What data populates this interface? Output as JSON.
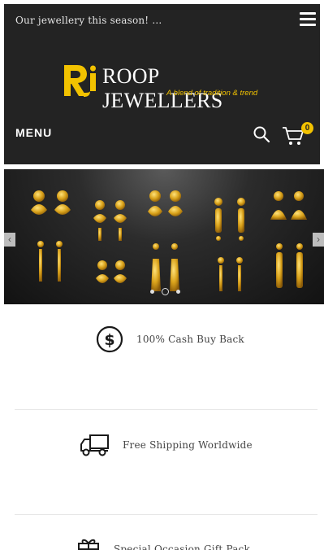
{
  "topbar": {
    "announcement": "Our jewellery this season! ..."
  },
  "logo": {
    "mark": "Rj",
    "name": "ROOP JEWELLERS",
    "tagline": "A blend of tradition & trend"
  },
  "nav": {
    "menu_label": "MENU",
    "cart_count": "0",
    "icons": [
      "hamburger-menu-icon",
      "search-icon",
      "cart-icon"
    ]
  },
  "slider": {
    "prev_glyph": "‹",
    "next_glyph": "›",
    "slide_count": 3,
    "active_slide": 2
  },
  "features": [
    {
      "icon": "dollar-coin-icon",
      "label": "100% Cash Buy Back"
    },
    {
      "icon": "delivery-truck-icon",
      "label": "Free Shipping Worldwide"
    },
    {
      "icon": "gift-box-icon",
      "label": "Special Occasion Gift Pack"
    }
  ],
  "colors": {
    "header_bg": "#232323",
    "accent_gold": "#f2c200",
    "text_gray": "#444444"
  }
}
